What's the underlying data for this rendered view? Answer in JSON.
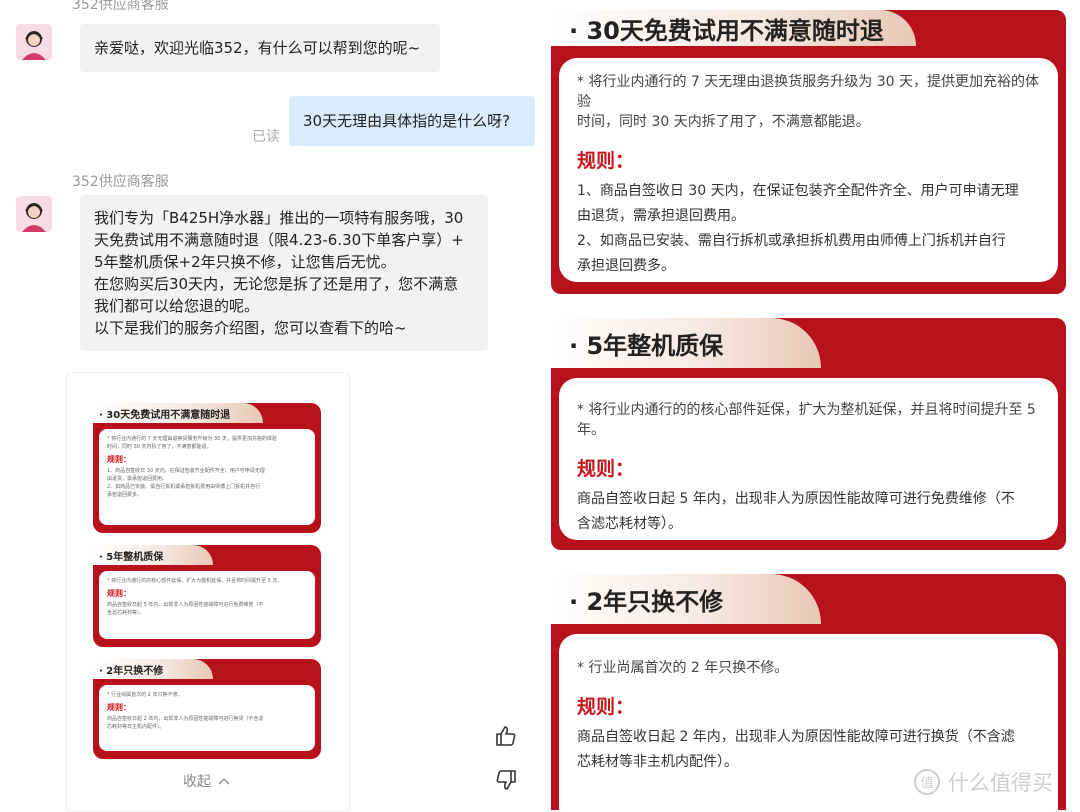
{
  "chat": {
    "sender_top": "352供应商客服",
    "greeting": "亲爱哒，欢迎光临352，有什么可以帮到您的呢~",
    "user_question": "30天无理由具体指的是什么呀?",
    "read_status": "已读",
    "sender": "352供应商客服",
    "reply_lines": [
      "我们专为「B425H净水器」推出的一项特有服务哦，30",
      "天免费试用不满意随时退（限4.23-6.30下单客户享）+",
      "5年整机质保+2年只换不修，让您售后无忧。",
      "在您购买后30天内，无论您是拆了还是用了，您不满意",
      "我们都可以给您退的呢。",
      "以下是我们的服务介绍图，您可以查看下的哈~"
    ],
    "collapse_label": "收起"
  },
  "icons": {
    "avatar": "agent-avatar-icon",
    "like": "thumbs-up-icon",
    "dislike": "thumbs-down-icon",
    "collapse": "chevron-up-icon",
    "watermark_logo": "smzdm-logo-icon"
  },
  "cards": [
    {
      "title": "· 30天免费试用不满意随时退",
      "note_lines": [
        "* 将行业内通行的 7 天无理由退换货服务升级为 30 天，提供更加充裕的体验",
        "时间，同时 30 天内拆了用了，不满意都能退。"
      ],
      "rule_heading": "规则：",
      "rule_lines": [
        "1、商品自签收日 30 天内，在保证包装齐全配件齐全、用户可申请无理",
        "由退货，需承担退回费用。",
        "2、如商品已安装、需自行拆机或承担拆机费用由师傅上门拆机并自行",
        "承担退回费多。"
      ]
    },
    {
      "title": "· 5年整机质保",
      "note_lines": [
        "* 将行业内通行的的核心部件延保，扩大为整机延保，并且将时间提升至 5 年。"
      ],
      "rule_heading": "规则：",
      "rule_lines": [
        "商品自签收日起 5 年内，出现非人为原因性能故障可进行免费维修（不",
        "含滤芯耗材等）。"
      ]
    },
    {
      "title": "· 2年只换不修",
      "note_lines": [
        "* 行业尚属首次的 2 年只换不修。"
      ],
      "rule_heading": "规则：",
      "rule_lines": [
        "商品自签收日起 2 年内，出现非人为原因性能故障可进行换货（不含滤",
        "芯耗材等非主机内配件）。"
      ]
    }
  ],
  "watermark": "什么值得买",
  "colors": {
    "card_red": "#b7121b",
    "rule_red": "#c8161d",
    "user_bubble": "#d9ecfb",
    "agent_bubble": "#f2f2f2"
  }
}
